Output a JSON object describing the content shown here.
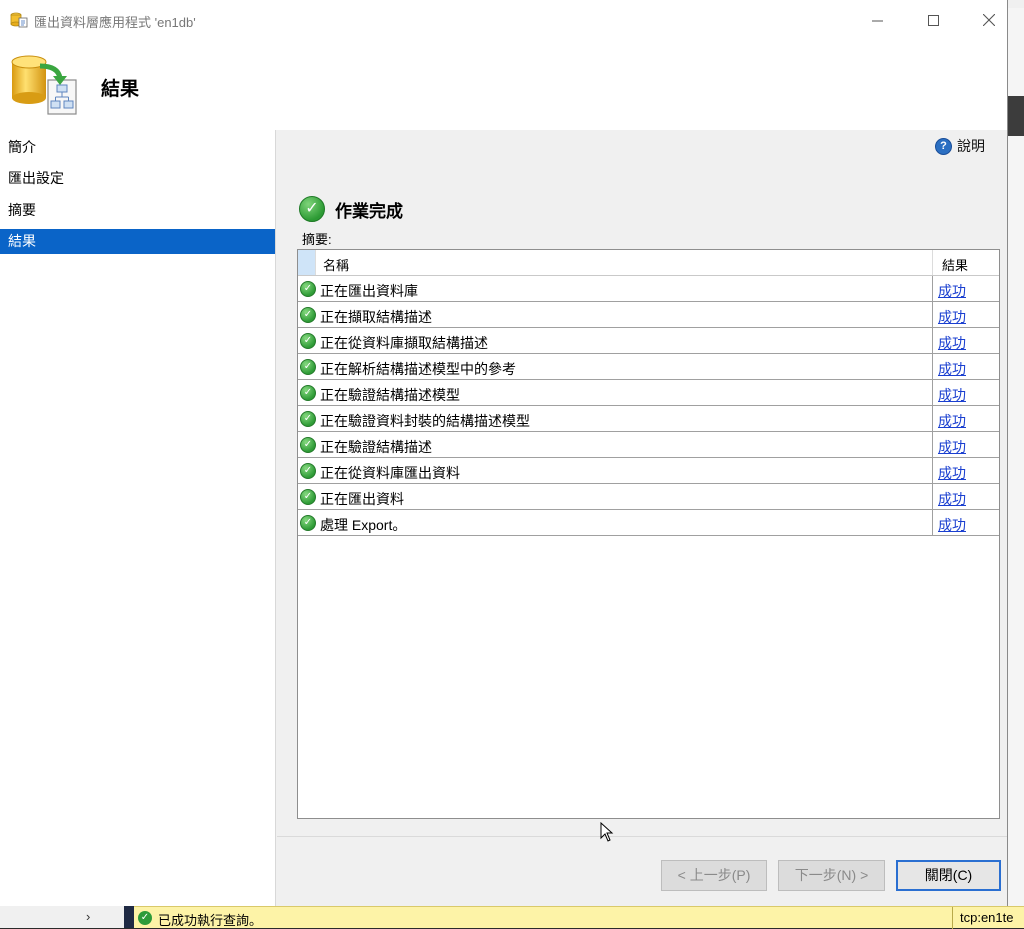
{
  "window": {
    "title": "匯出資料層應用程式 'en1db'"
  },
  "header": {
    "heading": "結果"
  },
  "nav": {
    "items": [
      {
        "label": "簡介"
      },
      {
        "label": "匯出設定"
      },
      {
        "label": "摘要"
      },
      {
        "label": "結果",
        "active": true
      }
    ]
  },
  "help": {
    "label": "說明"
  },
  "status": {
    "text": "作業完成",
    "summary_label": "摘要:"
  },
  "grid": {
    "columns": [
      "名稱",
      "結果"
    ],
    "rows": [
      {
        "name": "正在匯出資料庫",
        "result": "成功"
      },
      {
        "name": "正在擷取結構描述",
        "result": "成功"
      },
      {
        "name": "正在從資料庫擷取結構描述",
        "result": "成功"
      },
      {
        "name": "正在解析結構描述模型中的參考",
        "result": "成功"
      },
      {
        "name": "正在驗證結構描述模型",
        "result": "成功"
      },
      {
        "name": "正在驗證資料封裝的結構描述模型",
        "result": "成功"
      },
      {
        "name": "正在驗證結構描述",
        "result": "成功"
      },
      {
        "name": "正在從資料庫匯出資料",
        "result": "成功"
      },
      {
        "name": "正在匯出資料",
        "result": "成功"
      },
      {
        "name": "處理 Export。",
        "result": "成功"
      }
    ]
  },
  "buttons": {
    "prev": "< 上一步(P)",
    "next": "下一步(N) >",
    "close": "關閉(C)"
  },
  "background_app": {
    "status_message": "已成功執行查詢。",
    "server": "tcp:en1te"
  },
  "colors": {
    "accent": "#0a64c8",
    "link": "#1a3fd0",
    "success": "#2e9b36",
    "status_bar": "#fdf3a7"
  },
  "icons": {
    "app": "database-export-icon",
    "header": "database-export-icon",
    "help": "help-circle-icon",
    "success": "green-check-icon"
  }
}
